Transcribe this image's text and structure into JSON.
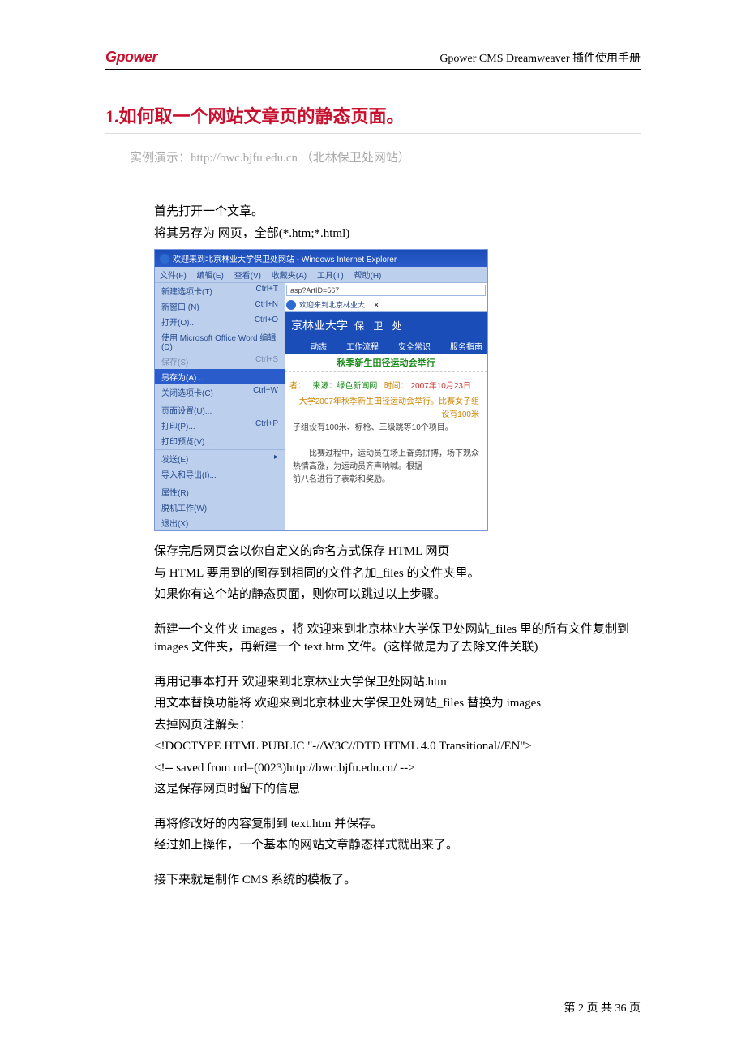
{
  "header": {
    "logo_text": "Gpower",
    "title": "Gpower CMS Dreamweaver 插件使用手册"
  },
  "section": {
    "heading": "1.如何取一个网站文章页的静态页面。",
    "demo_label": "实例演示：http://bwc.bjfu.edu.cn  （北林保卫处网站）"
  },
  "body": {
    "p1": "首先打开一个文章。",
    "p2": "将其另存为 网页，全部(*.htm;*.html)",
    "p3": "保存完后网页会以你自定义的命名方式保存 HTML 网页",
    "p4": "与 HTML 要用到的图存到相同的文件名加_files 的文件夹里。",
    "p5": "如果你有这个站的静态页面，则你可以跳过以上步骤。",
    "p6": "新建一个文件夹 images ，将 欢迎来到北京林业大学保卫处网站_files 里的所有文件复制到 images 文件夹，再新建一个  text.htm  文件。(这样做是为了去除文件关联)",
    "p7": "再用记事本打开  欢迎来到北京林业大学保卫处网站.htm",
    "p8": "用文本替换功能将 欢迎来到北京林业大学保卫处网站_files  替换为  images",
    "p9": "去掉网页注解头：",
    "p10": "<!DOCTYPE HTML PUBLIC \"-//W3C//DTD HTML 4.0 Transitional//EN\">",
    "p11": "<!-- saved from url=(0023)http://bwc.bjfu.edu.cn/ -->",
    "p12": "这是保存网页时留下的信息",
    "p13": "再将修改好的内容复制到  text.htm  并保存。",
    "p14": "经过如上操作，一个基本的网站文章静态样式就出来了。",
    "p15": "接下来就是制作 CMS 系统的模板了。"
  },
  "ie": {
    "titlebar": "欢迎来到北京林业大学保卫处网站 - Windows Internet Explorer",
    "menu": {
      "file": "文件(F)",
      "edit": "编辑(E)",
      "view": "查看(V)",
      "fav": "收藏夹(A)",
      "tools": "工具(T)",
      "help": "帮助(H)"
    },
    "dropdown": [
      {
        "label": "新建选项卡(T)",
        "shortcut": "Ctrl+T"
      },
      {
        "label": "新窗口  (N)",
        "shortcut": "Ctrl+N"
      },
      {
        "label": "打开(O)...",
        "shortcut": "Ctrl+O"
      },
      {
        "label": "使用 Microsoft Office Word 编辑(D)",
        "shortcut": ""
      },
      {
        "label": "保存(S)",
        "shortcut": "Ctrl+S",
        "disabled": true
      },
      {
        "label": "另存为(A)...",
        "shortcut": "",
        "highlight": true
      },
      {
        "label": "关闭选项卡(C)",
        "shortcut": "Ctrl+W"
      },
      {
        "label": "页面设置(U)...",
        "shortcut": ""
      },
      {
        "label": "打印(P)...",
        "shortcut": "Ctrl+P"
      },
      {
        "label": "打印预览(V)...",
        "shortcut": ""
      },
      {
        "label": "发送(E)",
        "shortcut": "▸"
      },
      {
        "label": "导入和导出(I)...",
        "shortcut": ""
      },
      {
        "label": "属性(R)",
        "shortcut": ""
      },
      {
        "label": "脱机工作(W)",
        "shortcut": ""
      },
      {
        "label": "退出(X)",
        "shortcut": ""
      }
    ],
    "address": "asp?ArtID=567",
    "tab_text": "欢迎来到北京林业大...",
    "banner_main": "京林业大学",
    "banner_sub": "保 卫 处",
    "nav_items": [
      "动态",
      "工作流程",
      "安全常识",
      "服务指南"
    ],
    "green_headline": "秋季新生田径运动会举行",
    "meta_author": "者：",
    "meta_source": "来源：绿色新闻网",
    "meta_time_label": "时间：",
    "meta_time_value": "2007年10月23日",
    "article_l1": "大学2007年秋季新生田径运动会举行。比赛女子组设有100米",
    "article_l2": "子组设有100米、标枪、三级跳等10个项目。",
    "article_l3": "比赛过程中，运动员在场上奋勇拼搏，场下观众热情高涨，为运动员齐声呐喊。根据",
    "article_l4": "前八名进行了表彰和奖励。"
  },
  "footer": {
    "text": "第 2 页 共 36 页"
  }
}
